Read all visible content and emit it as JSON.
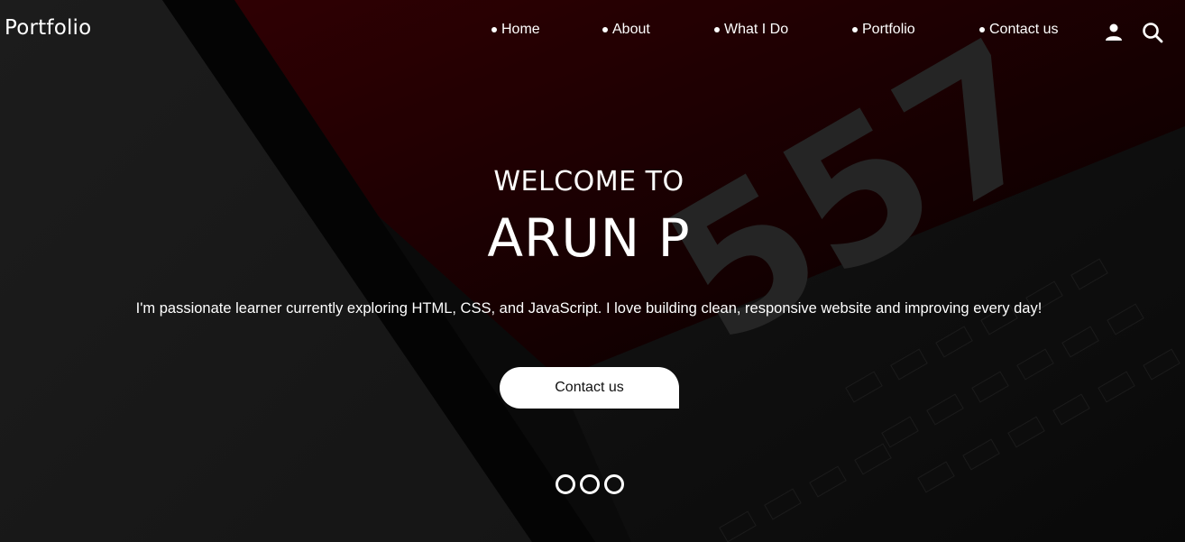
{
  "brand": {
    "title": "Portfolio"
  },
  "nav": {
    "items": [
      {
        "label": "Home"
      },
      {
        "label": "About"
      },
      {
        "label": "What I Do"
      },
      {
        "label": "Portfolio"
      },
      {
        "label": "Contact us"
      }
    ],
    "icons": [
      "user-icon",
      "search-icon"
    ]
  },
  "hero": {
    "welcome": "WELCOME TO",
    "name": "ARUN P",
    "tagline": "I'm passionate learner currently exploring HTML, CSS, and JavaScript. I love building clean, responsive website and improving every day!",
    "cta_label": "Contact us"
  },
  "slider": {
    "dot_count": 3
  },
  "colors": {
    "background": "#0b0b0b",
    "accent_red": "#2a0002",
    "text": "#ffffff",
    "button_bg": "#ffffff"
  }
}
